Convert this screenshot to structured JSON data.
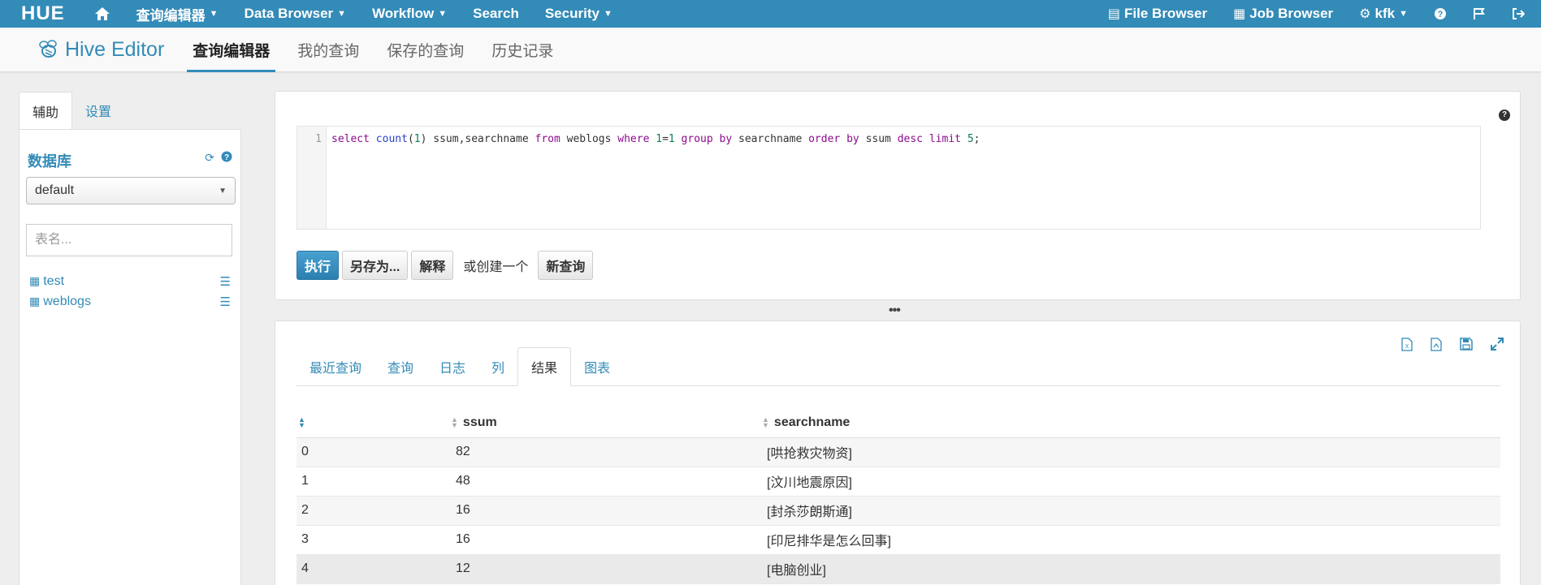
{
  "topnav": {
    "logo": "HUE",
    "items": [
      {
        "label": "查询编辑器",
        "dropdown": true
      },
      {
        "label": "Data Browser",
        "dropdown": true
      },
      {
        "label": "Workflow",
        "dropdown": true
      },
      {
        "label": "Search",
        "dropdown": false
      },
      {
        "label": "Security",
        "dropdown": true
      }
    ],
    "right": {
      "file_browser": "File Browser",
      "job_browser": "Job Browser",
      "user": "kfk"
    }
  },
  "subnav": {
    "app_title": "Hive Editor",
    "tabs": [
      "查询编辑器",
      "我的查询",
      "保存的查询",
      "历史记录"
    ],
    "active_tab": 0
  },
  "sidebar": {
    "tabs": [
      "辅助",
      "设置"
    ],
    "db_title": "数据库",
    "db_selected": "default",
    "table_filter_placeholder": "表名...",
    "tables": [
      "test",
      "weblogs"
    ]
  },
  "editor": {
    "line_number": "1",
    "query": "select count(1) ssum,searchname from weblogs where 1=1 group by searchname order by ssum desc limit 5;",
    "buttons": {
      "execute": "执行",
      "save_as": "另存为...",
      "explain": "解释",
      "or_create": "或创建一个",
      "new_query": "新查询"
    }
  },
  "results": {
    "tabs": [
      "最近查询",
      "查询",
      "日志",
      "列",
      "结果",
      "图表"
    ],
    "active_tab": 4,
    "columns": [
      "",
      "ssum",
      "searchname"
    ],
    "rows": [
      [
        "0",
        "82",
        "[哄抢救灾物资]"
      ],
      [
        "1",
        "48",
        "[汶川地震原因]"
      ],
      [
        "2",
        "16",
        "[封杀莎朗斯通]"
      ],
      [
        "3",
        "16",
        "[印尼排华是怎么回事]"
      ],
      [
        "4",
        "12",
        "[电脑创业]"
      ]
    ]
  },
  "colors": {
    "brand": "#338bb8",
    "primary_button": "#338bb8"
  }
}
